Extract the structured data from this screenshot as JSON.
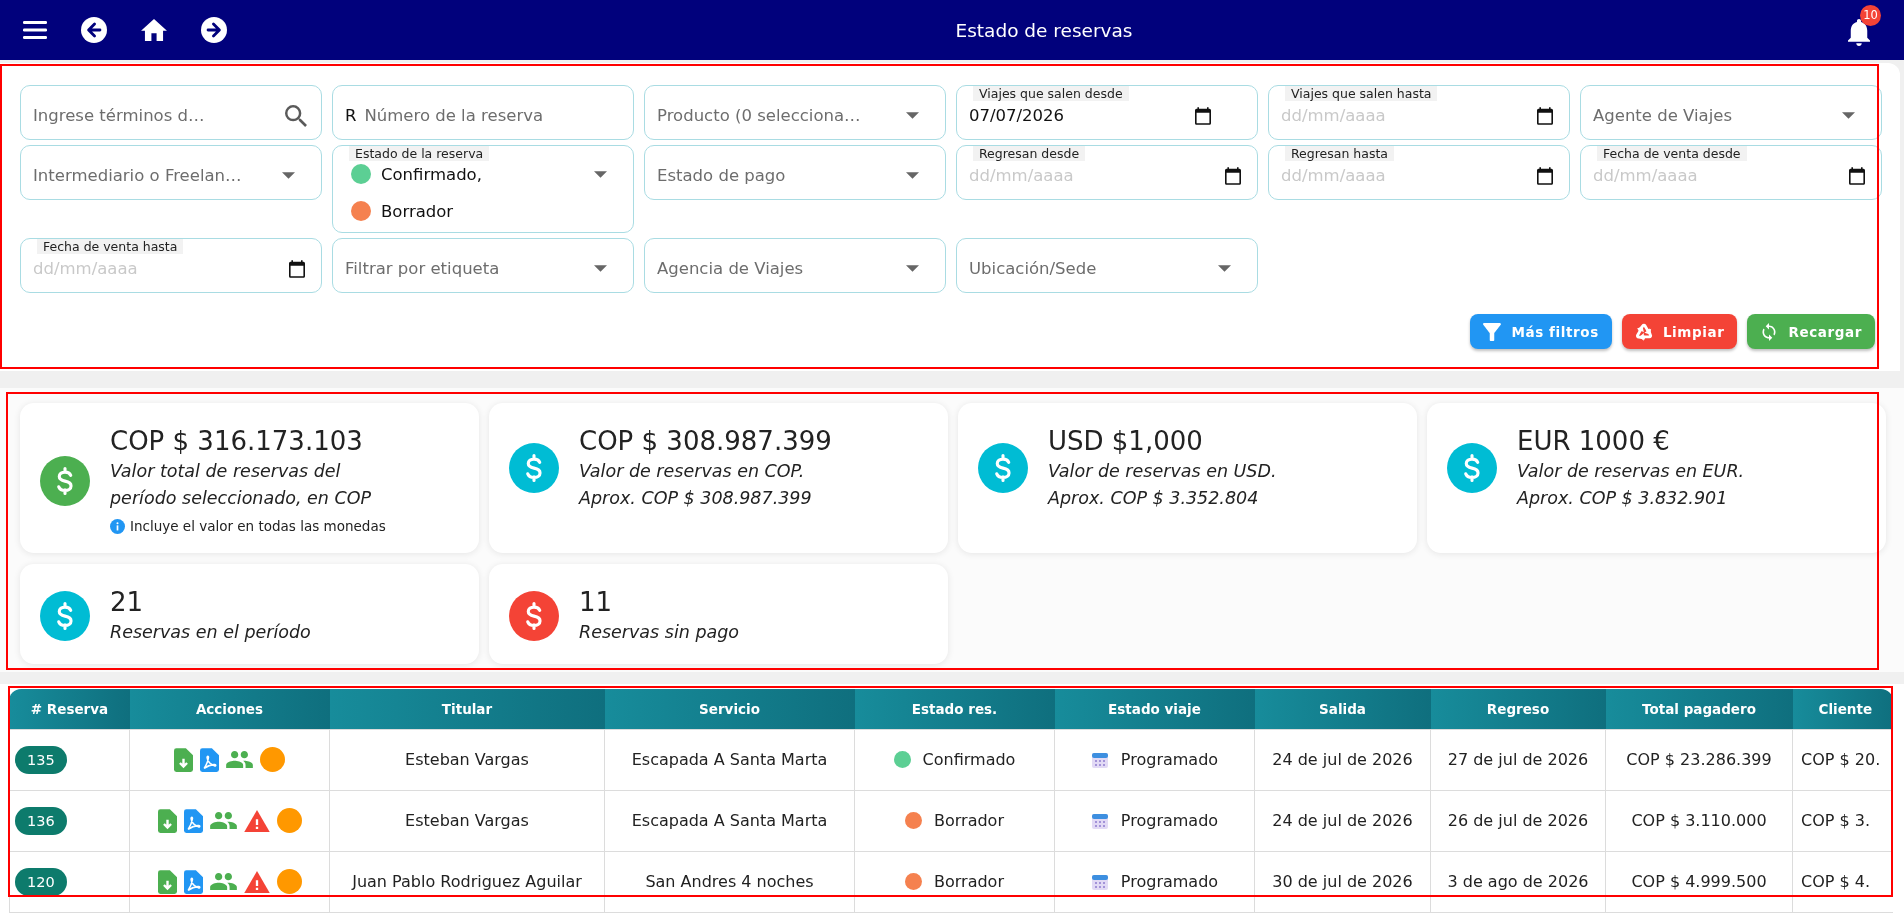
{
  "top_bar": {
    "title": "Estado de reservas",
    "notification_count": "10"
  },
  "filters": {
    "fields": [
      {
        "kind": "search",
        "placeholder": "Ingrese términos d…"
      },
      {
        "kind": "text",
        "prefix": "R",
        "placeholder": "Número de la reserva"
      },
      {
        "kind": "select",
        "placeholder": "Producto (0 selecciona…"
      },
      {
        "kind": "date",
        "label": "Viajes que salen desde",
        "value": "07/07/2026"
      },
      {
        "kind": "date",
        "label": "Viajes que salen hasta",
        "placeholder": "dd/mm/aaaa"
      },
      {
        "kind": "select",
        "placeholder": "Agente de Viajes"
      },
      {
        "kind": "select",
        "placeholder": "Intermediario o Freelan…"
      },
      {
        "kind": "multiselect",
        "label": "Estado de la reserva",
        "chips": [
          {
            "label": "Confirmado,",
            "color": "#5ccf94"
          },
          {
            "label": "Borrador",
            "color": "#f5814f"
          }
        ]
      },
      {
        "kind": "select",
        "placeholder": "Estado de pago"
      },
      {
        "kind": "date",
        "label": "Regresan desde",
        "placeholder": "dd/mm/aaaa"
      },
      {
        "kind": "date",
        "label": "Regresan hasta",
        "placeholder": "dd/mm/aaaa"
      },
      {
        "kind": "date",
        "label": "Fecha de venta desde",
        "placeholder": "dd/mm/aaaa"
      },
      {
        "kind": "date",
        "label": "Fecha de venta hasta",
        "placeholder": "dd/mm/aaaa"
      },
      {
        "kind": "select",
        "placeholder": "Filtrar por etiqueta"
      },
      {
        "kind": "select",
        "placeholder": "Agencia de Viajes"
      },
      {
        "kind": "select",
        "placeholder": "Ubicación/Sede"
      }
    ],
    "buttons": [
      {
        "kind": "filter",
        "label": "Más filtros"
      },
      {
        "kind": "clear",
        "label": "Limpiar"
      },
      {
        "kind": "reload",
        "label": "Recargar"
      }
    ]
  },
  "summary_cards": [
    {
      "value": "COP $ 316.173.103",
      "description": "Valor total de reservas del período seleccionado, en COP",
      "note": "Incluye el valor en todas las monedas",
      "color": "#4caf50"
    },
    {
      "value": "COP $ 308.987.399",
      "description": "Valor de reservas en COP.",
      "approx": "Aprox. COP $ 308.987.399",
      "color": "#00bcd4"
    },
    {
      "value": "USD $1,000",
      "description": "Valor de reservas en USD.",
      "approx": "Aprox. COP $ 3.352.804",
      "color": "#00bcd4"
    },
    {
      "value": "EUR 1000 €",
      "description": "Valor de reservas en EUR.",
      "approx": "Aprox. COP $ 3.832.901",
      "color": "#00bcd4"
    },
    {
      "value": "21",
      "description": "Reservas en el período",
      "color": "#00bcd4"
    },
    {
      "value": "11",
      "description": "Reservas sin pago",
      "color": "#f44336"
    }
  ],
  "table": {
    "columns": [
      "# Reserva",
      "Acciones",
      "Titular",
      "Servicio",
      "Estado res.",
      "Estado viaje",
      "Salida",
      "Regreso",
      "Total pagadero",
      "Cliente"
    ],
    "rows": [
      {
        "reservation": "135",
        "warning": false,
        "holder": "Esteban Vargas",
        "service": "Escapada A Santa Marta",
        "status": {
          "label": "Confirmado",
          "color": "#5ccf94"
        },
        "trip_status": "Programado",
        "departure": "24 de jul de 2026",
        "return": "27 de jul de 2026",
        "total": "COP $ 23.286.399",
        "client_total": "COP $ 20."
      },
      {
        "reservation": "136",
        "warning": true,
        "holder": "Esteban Vargas",
        "service": "Escapada A Santa Marta",
        "status": {
          "label": "Borrador",
          "color": "#f5814f"
        },
        "trip_status": "Programado",
        "departure": "24 de jul de 2026",
        "return": "26 de jul de 2026",
        "total": "COP $ 3.110.000",
        "client_total": "COP $ 3."
      },
      {
        "reservation": "120",
        "warning": true,
        "holder": "Juan Pablo Rodriguez Aguilar",
        "service": "San Andres 4 noches",
        "status": {
          "label": "Borrador",
          "color": "#f5814f"
        },
        "trip_status": "Programado",
        "departure": "30 de jul de 2026",
        "return": "3 de ago de 2026",
        "total": "COP $ 4.999.500",
        "client_total": "COP $ 4."
      }
    ]
  }
}
